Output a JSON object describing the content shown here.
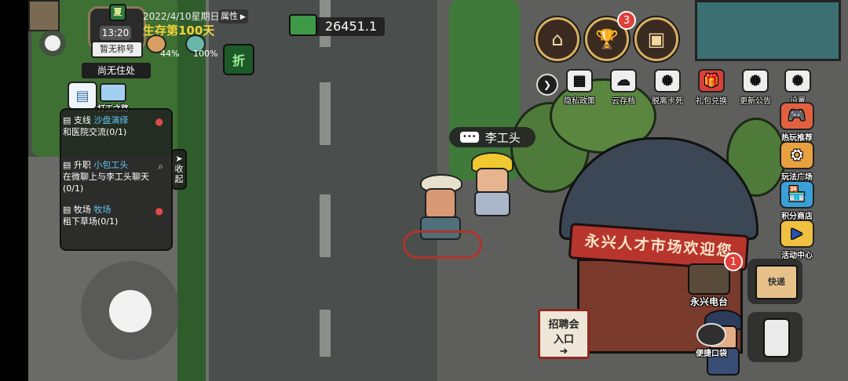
{
  "status": {
    "season_icon_label": "夏",
    "time": "13:20",
    "date": "2022/4/10星期日",
    "survival_day": "生存第100天",
    "attributes_label": "属性",
    "title": "暂无称号",
    "residence": "尚无住处",
    "stat_1": "44%",
    "stat_2": "100%",
    "discount_label": "折"
  },
  "money": {
    "value": "26451.1"
  },
  "left_shortcuts": {
    "work_label": "打工之路"
  },
  "tasks": {
    "collapse_label": "收起",
    "items": [
      {
        "type": "支线",
        "location": "沙盘演绎",
        "desc": "和医院交流(0/1)"
      },
      {
        "type": "升职",
        "location": "小包工头",
        "desc": "在微聊上与李工头聊天(0/1)"
      },
      {
        "type": "牧场",
        "location": "牧场",
        "desc": "租下草场(0/1)"
      }
    ]
  },
  "npc": {
    "name": "李工头"
  },
  "scene_text": {
    "banner": "永兴人才市场欢迎您",
    "sign_line1": "招聘会",
    "sign_line2": "入口",
    "radio_label": "永兴电台",
    "convenience_label": "便捷口袋",
    "box_label": "快递"
  },
  "top_buttons": {
    "trophy_badge": "3",
    "radio_badge": "1"
  },
  "top_menu": [
    {
      "label": "隐私政策",
      "icon": "document-icon",
      "glyph": "▤"
    },
    {
      "label": "云存档",
      "icon": "cloud-save-icon",
      "glyph": "☁"
    },
    {
      "label": "脱离卡死",
      "icon": "unstuck-icon",
      "glyph": "⚙"
    },
    {
      "label": "礼包兑换",
      "icon": "gift-icon",
      "glyph": "🎁"
    },
    {
      "label": "更新公告",
      "icon": "announcement-icon",
      "glyph": "⚙"
    },
    {
      "label": "设置",
      "icon": "settings-gear-icon",
      "glyph": "⚙"
    }
  ],
  "side_menu": [
    {
      "label": "热玩推荐",
      "icon": "hot-game-icon",
      "glyph": "🎮"
    },
    {
      "label": "玩法广场",
      "icon": "plaza-icon",
      "glyph": "⛭"
    },
    {
      "label": "积分商店",
      "icon": "points-shop-icon",
      "glyph": "🏪"
    },
    {
      "label": "活动中心",
      "icon": "event-center-icon",
      "glyph": "▶"
    }
  ],
  "colors": {
    "accent_gold": "#d9b060",
    "task_location": "#5fc7f2",
    "badge_red": "#e0403a",
    "survival_text": "#f2d23c"
  }
}
